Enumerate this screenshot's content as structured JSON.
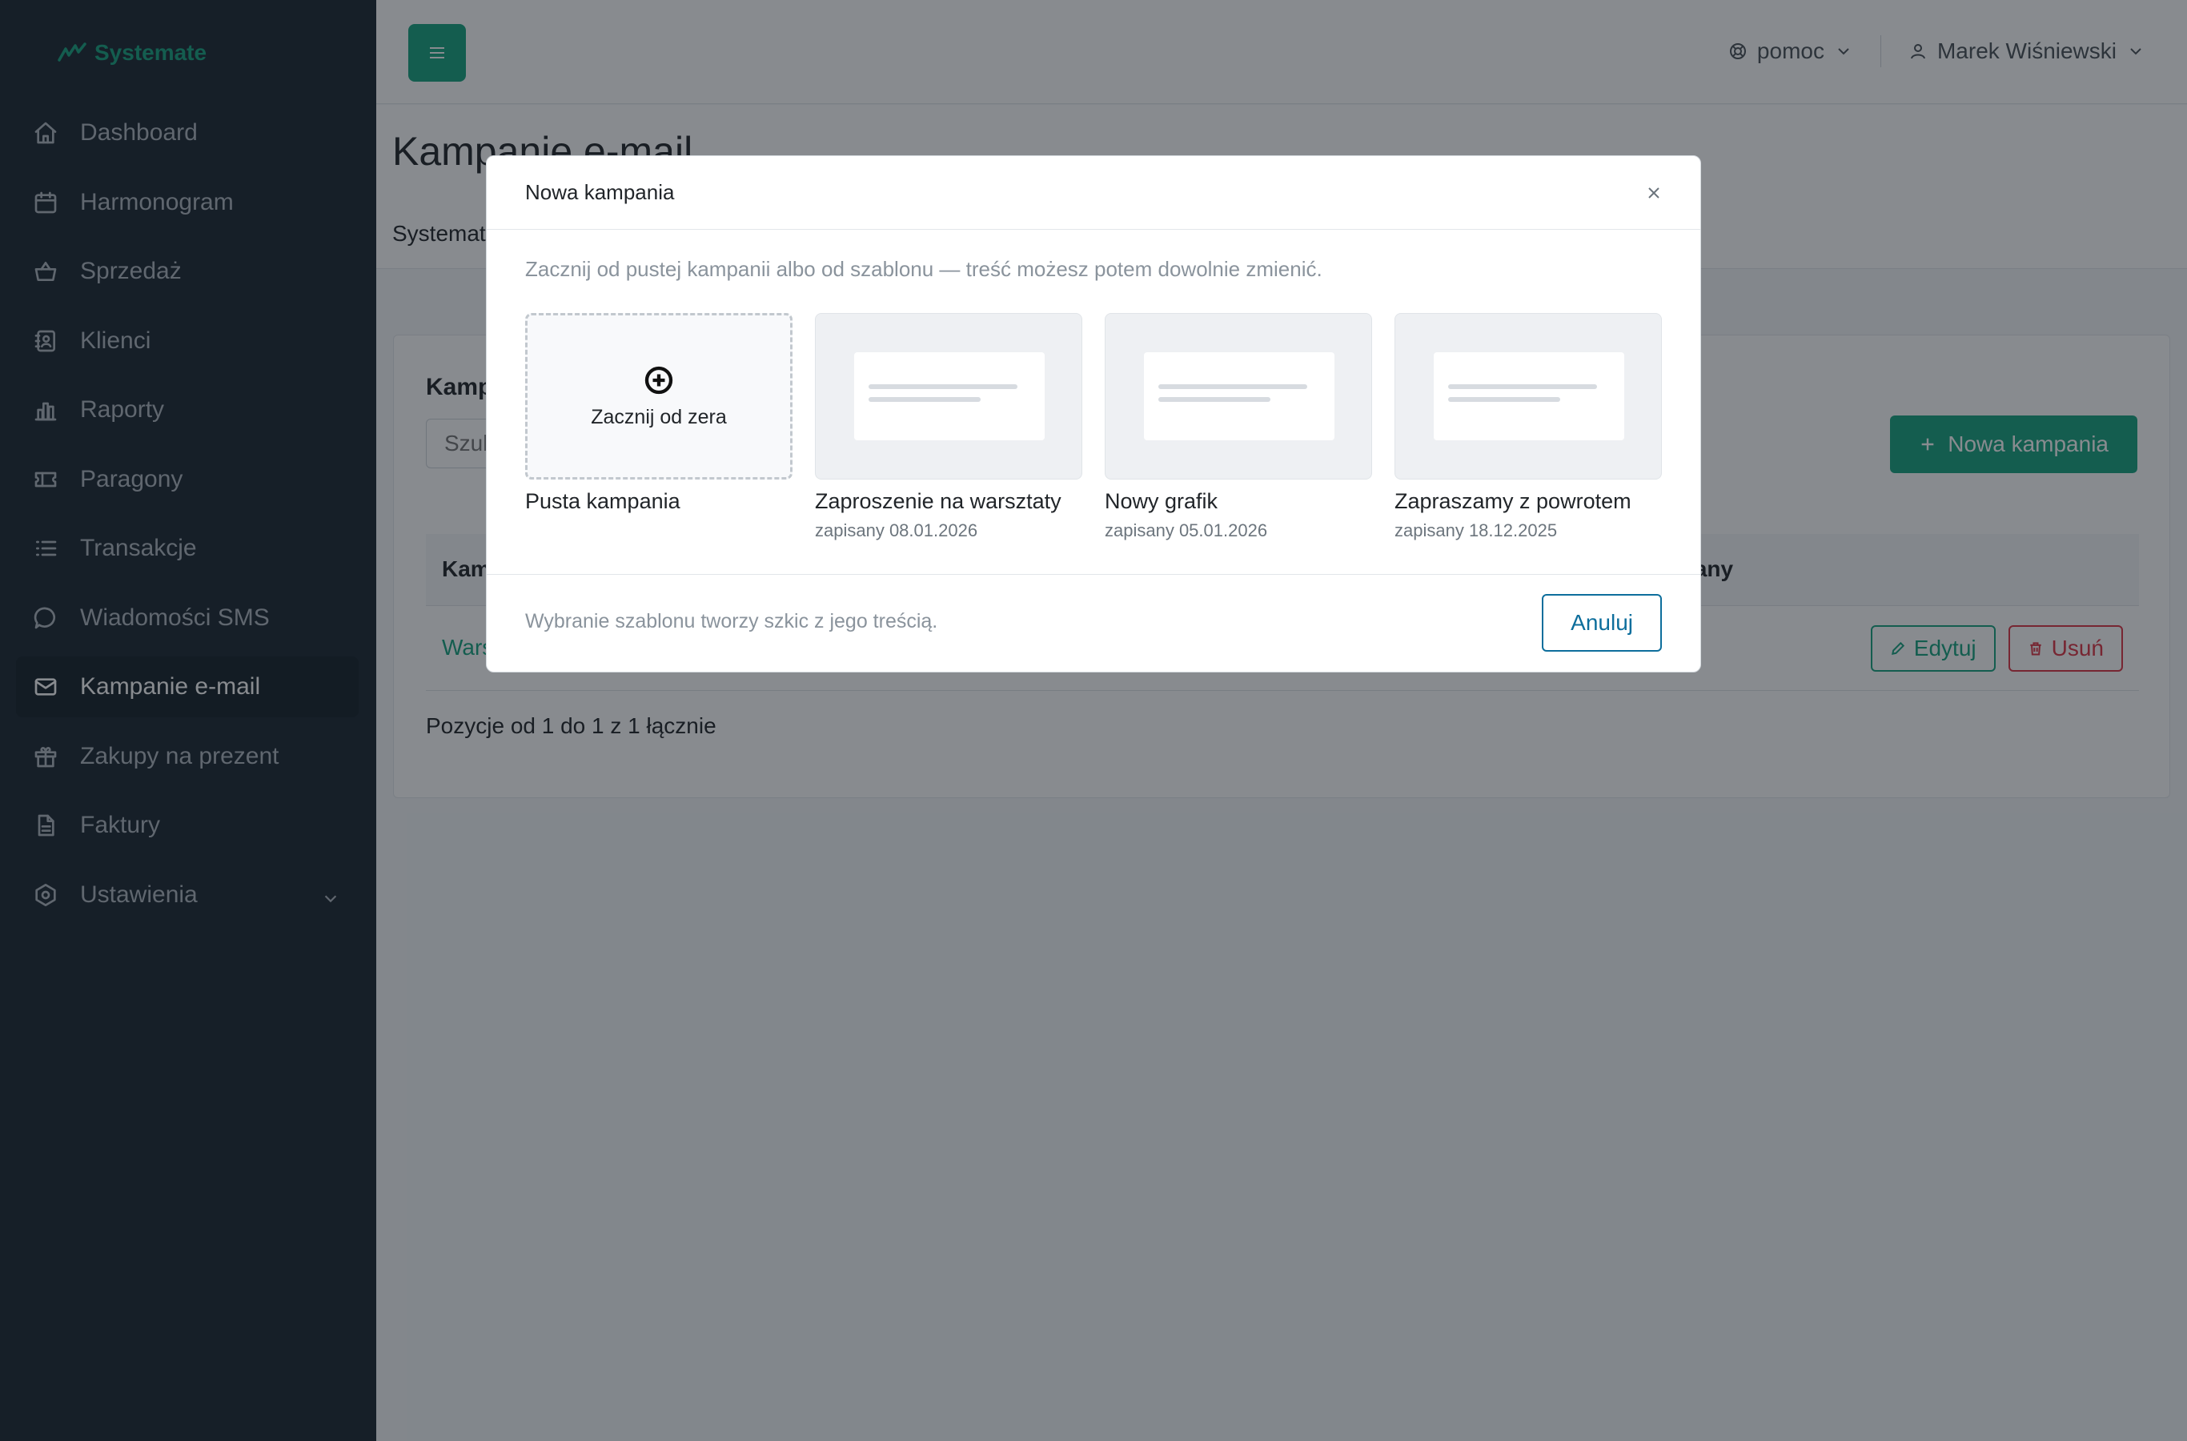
{
  "brand": {
    "name": "Systemate",
    "color": "#17a37f"
  },
  "sidebar": {
    "items": [
      {
        "label": "Dashboard",
        "icon": "home-icon"
      },
      {
        "label": "Harmonogram",
        "icon": "calendar-icon"
      },
      {
        "label": "Sprzedaż",
        "icon": "basket-icon"
      },
      {
        "label": "Klienci",
        "icon": "address-book-icon"
      },
      {
        "label": "Raporty",
        "icon": "bar-chart-icon"
      },
      {
        "label": "Paragony",
        "icon": "ticket-icon"
      },
      {
        "label": "Transakcje",
        "icon": "list-icon"
      },
      {
        "label": "Wiadomości SMS",
        "icon": "chat-icon"
      },
      {
        "label": "Kampanie e-mail",
        "icon": "mail-icon",
        "active": true
      },
      {
        "label": "Zakupy na prezent",
        "icon": "gift-icon"
      },
      {
        "label": "Faktury",
        "icon": "document-icon"
      },
      {
        "label": "Ustawienia",
        "icon": "settings-icon",
        "expandable": true
      }
    ]
  },
  "topbar": {
    "help_label": "pomoc",
    "user_name": "Marek Wiśniewski"
  },
  "page": {
    "title": "Kampanie e-mail",
    "breadcrumb": "Systemate"
  },
  "card": {
    "title": "Kampanie e-mail",
    "search_placeholder": "Szukaj...",
    "new_button": "Nowa kampania",
    "columns": [
      "Kampania",
      "Wysłany"
    ],
    "rows": [
      {
        "name": "Warsztaty"
      }
    ],
    "edit_label": "Edytuj",
    "delete_label": "Usuń",
    "pager": "Pozycje od 1 do 1 z 1 łącznie"
  },
  "modal": {
    "title": "Nowa kampania",
    "intro": "Zacznij od pustej kampanii albo od szablonu — treść możesz potem dowolnie zmienić.",
    "blank_tile_label": "Zacznij od zera",
    "tiles": [
      {
        "name": "Pusta kampania",
        "date": ""
      },
      {
        "name": "Zaproszenie na warsztaty",
        "date": "zapisany 08.01.2026"
      },
      {
        "name": "Nowy grafik",
        "date": "zapisany 05.01.2026"
      },
      {
        "name": "Zapraszamy z powrotem",
        "date": "zapisany 18.12.2025"
      }
    ],
    "footer_note": "Wybranie szablonu tworzy szkic z jego treścią.",
    "cancel_label": "Anuluj"
  }
}
